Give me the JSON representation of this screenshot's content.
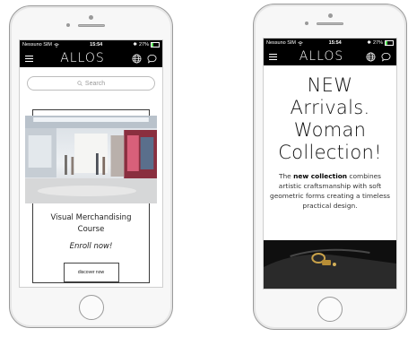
{
  "left_phone": {
    "status": {
      "carrier": "Nessuno SIM",
      "time": "15:54",
      "battery": "27%"
    },
    "logo": "ALLOS",
    "search": {
      "placeholder": "Search"
    },
    "card": {
      "title_line1": "Visual Merchandising",
      "title_line2": "Course",
      "enroll": "Enroll now!",
      "button": "discover now"
    }
  },
  "right_phone": {
    "status": {
      "carrier": "Nessuno SIM",
      "time": "15:54",
      "battery": "27%"
    },
    "logo": "ALLOS",
    "hero": {
      "line1": "NEW",
      "line2": "Arrivals.",
      "line3": "Woman",
      "line4": "Collection!"
    },
    "desc": {
      "pre": "The ",
      "bold": "new collection",
      "post": " combines artistic craftsmanship with soft geometric forms creating a timeless practical design."
    }
  },
  "icons": {
    "menu": "hamburger-icon",
    "language": "globe-icon",
    "chat": "chat-icon",
    "search": "search-icon",
    "wifi": "wifi-icon",
    "bluetooth": "bluetooth-icon",
    "battery": "battery-icon"
  },
  "colors": {
    "bar": "#000000",
    "battery_fill": "#4ee04e",
    "frame": "#9a9a9a"
  }
}
